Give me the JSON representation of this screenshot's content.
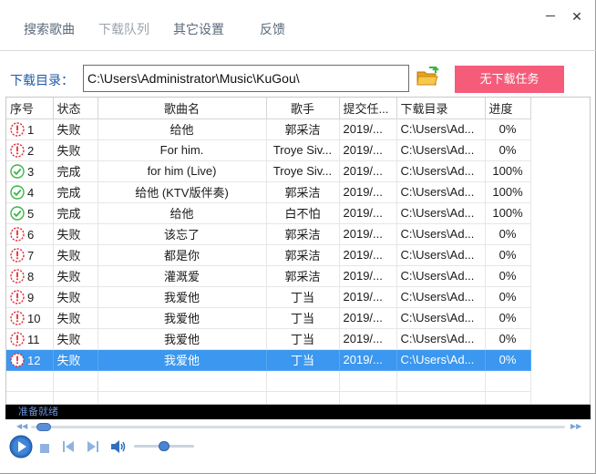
{
  "tabs": [
    {
      "label": "搜索歌曲"
    },
    {
      "label": "下载队列"
    },
    {
      "label": "其它设置"
    },
    {
      "label": "反馈"
    }
  ],
  "window": {
    "minimize_label": "－",
    "close_label": "✕"
  },
  "directory": {
    "label": "下载目录：",
    "value": "C:\\Users\\Administrator\\Music\\KuGou\\",
    "button_label": "无下载任务"
  },
  "table": {
    "headers": [
      "序号",
      "状态",
      "歌曲名",
      "歌手",
      "提交任...",
      "下载目录",
      "进度"
    ],
    "rows": [
      {
        "icon": "error",
        "no": "1",
        "status": "失败",
        "song": "给他",
        "artist": "郭采洁",
        "time": "2019/...",
        "dir": "C:\\Users\\Ad...",
        "progress": "0%"
      },
      {
        "icon": "error",
        "no": "2",
        "status": "失败",
        "song": "For him.",
        "artist": "Troye Siv...",
        "time": "2019/...",
        "dir": "C:\\Users\\Ad...",
        "progress": "0%"
      },
      {
        "icon": "ok",
        "no": "3",
        "status": "完成",
        "song": "for him (Live)",
        "artist": "Troye Siv...",
        "time": "2019/...",
        "dir": "C:\\Users\\Ad...",
        "progress": "100%"
      },
      {
        "icon": "ok",
        "no": "4",
        "status": "完成",
        "song": "给他 (KTV版伴奏)",
        "artist": "郭采洁",
        "time": "2019/...",
        "dir": "C:\\Users\\Ad...",
        "progress": "100%"
      },
      {
        "icon": "ok",
        "no": "5",
        "status": "完成",
        "song": "给他",
        "artist": "白不怕",
        "time": "2019/...",
        "dir": "C:\\Users\\Ad...",
        "progress": "100%"
      },
      {
        "icon": "error",
        "no": "6",
        "status": "失败",
        "song": "该忘了",
        "artist": "郭采洁",
        "time": "2019/...",
        "dir": "C:\\Users\\Ad...",
        "progress": "0%"
      },
      {
        "icon": "error",
        "no": "7",
        "status": "失败",
        "song": "都是你",
        "artist": "郭采洁",
        "time": "2019/...",
        "dir": "C:\\Users\\Ad...",
        "progress": "0%"
      },
      {
        "icon": "error",
        "no": "8",
        "status": "失败",
        "song": "灌溉爱",
        "artist": "郭采洁",
        "time": "2019/...",
        "dir": "C:\\Users\\Ad...",
        "progress": "0%"
      },
      {
        "icon": "error",
        "no": "9",
        "status": "失败",
        "song": "我爱他",
        "artist": "丁当",
        "time": "2019/...",
        "dir": "C:\\Users\\Ad...",
        "progress": "0%"
      },
      {
        "icon": "error",
        "no": "10",
        "status": "失败",
        "song": "我爱他",
        "artist": "丁当",
        "time": "2019/...",
        "dir": "C:\\Users\\Ad...",
        "progress": "0%"
      },
      {
        "icon": "error",
        "no": "11",
        "status": "失败",
        "song": "我爱他",
        "artist": "丁当",
        "time": "2019/...",
        "dir": "C:\\Users\\Ad...",
        "progress": "0%"
      },
      {
        "icon": "error",
        "no": "12",
        "status": "失败",
        "song": "我爱他",
        "artist": "丁当",
        "time": "2019/...",
        "dir": "C:\\Users\\Ad...",
        "progress": "0%",
        "selected": true
      }
    ]
  },
  "status_bar": {
    "text": "准备就绪"
  },
  "player": {
    "seek_fraction": 0.01,
    "volume_fraction": 0.5
  },
  "colors": {
    "accent_button": "#f45c7a",
    "selection": "#3b97ef",
    "label_blue": "#1f5aa6",
    "error_red": "#e0303a",
    "ok_green": "#3cb449"
  }
}
